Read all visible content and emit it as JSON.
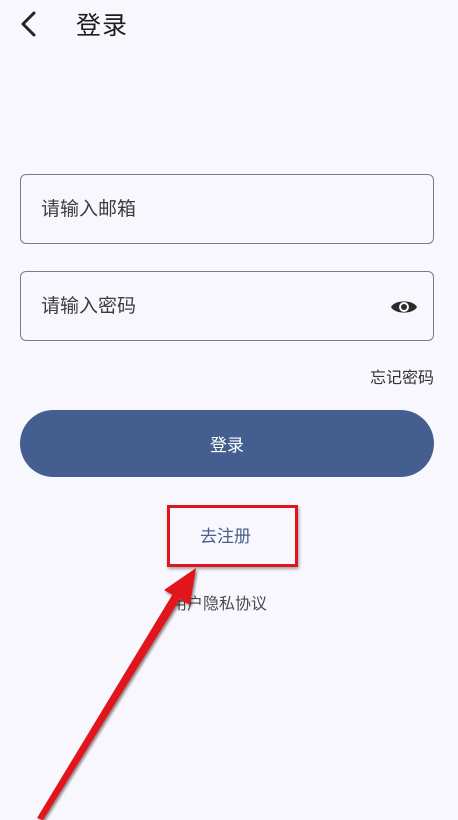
{
  "header": {
    "title": "登录",
    "back_icon": "chevron-left-icon"
  },
  "form": {
    "email_placeholder": "请输入邮箱",
    "email_value": "",
    "password_placeholder": "请输入密码",
    "password_value": "",
    "password_toggle_icon": "eye-icon",
    "forgot_label": "忘记密码",
    "login_label": "登录"
  },
  "links": {
    "register_label": "去注册",
    "privacy_label": "用户隐私协议"
  },
  "colors": {
    "background": "#f7f7fd",
    "primary": "#445f8f",
    "link": "#4a5f8a",
    "annotation": "#e0161e"
  }
}
